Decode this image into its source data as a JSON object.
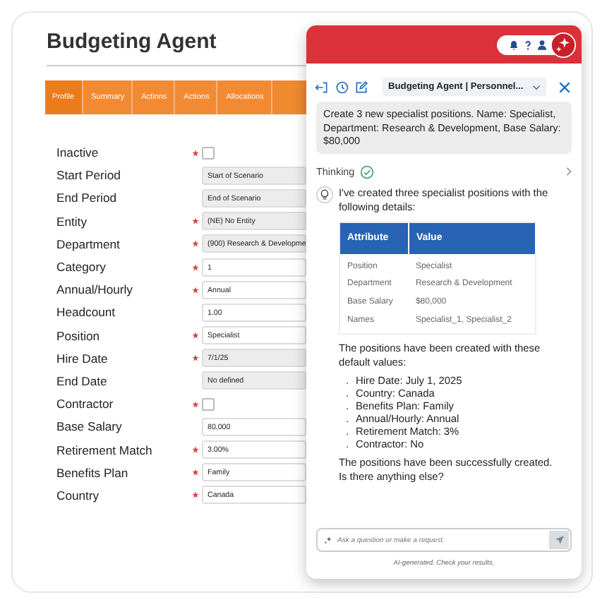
{
  "page": {
    "title": "Budgeting Agent"
  },
  "tabs": [
    {
      "label": "Profile",
      "selected": true
    },
    {
      "label": "Summary",
      "selected": false
    },
    {
      "label": "Actions",
      "selected": false
    },
    {
      "label": "Actions",
      "selected": false
    },
    {
      "label": "Allocations",
      "selected": false
    }
  ],
  "form": [
    {
      "label": "Inactive",
      "kind": "checkbox",
      "required": true,
      "checked": false
    },
    {
      "label": "Start Period",
      "kind": "text",
      "required": false,
      "disabled": true,
      "value": "Start of Scenario"
    },
    {
      "label": "End Period",
      "kind": "text",
      "required": false,
      "disabled": true,
      "value": "End of Scenario"
    },
    {
      "label": "Entity",
      "kind": "text",
      "required": true,
      "disabled": true,
      "value": "(NE) No Entity"
    },
    {
      "label": "Department",
      "kind": "text",
      "required": true,
      "disabled": true,
      "value": "(900) Research & Developme"
    },
    {
      "label": "Category",
      "kind": "text",
      "required": true,
      "disabled": false,
      "value": "1"
    },
    {
      "label": "Annual/Hourly",
      "kind": "text",
      "required": true,
      "disabled": false,
      "value": "Annual"
    },
    {
      "label": "Headcount",
      "kind": "text",
      "required": false,
      "disabled": false,
      "value": "1.00"
    },
    {
      "label": "Position",
      "kind": "text",
      "required": true,
      "disabled": false,
      "value": "Specialist"
    },
    {
      "label": "Hire Date",
      "kind": "text",
      "required": true,
      "disabled": true,
      "value": "7/1/25"
    },
    {
      "label": "End Date",
      "kind": "text",
      "required": false,
      "disabled": true,
      "value": "No defined"
    },
    {
      "label": "Contractor",
      "kind": "checkbox",
      "required": true,
      "checked": false
    },
    {
      "label": "Base Salary",
      "kind": "text",
      "required": false,
      "disabled": false,
      "value": "80,000"
    },
    {
      "label": "Retirement Match",
      "kind": "text",
      "required": true,
      "disabled": false,
      "value": "3.00%"
    },
    {
      "label": "Benefits Plan",
      "kind": "text",
      "required": true,
      "disabled": false,
      "value": "Family"
    },
    {
      "label": "Country",
      "kind": "text",
      "required": true,
      "disabled": false,
      "value": "Canada"
    }
  ],
  "chat": {
    "agent_select": "Budgeting Agent | Personnel...",
    "user_message": "Create 3 new specialist positions. Name: Specialist, Department: Research & Development, Base Salary: $80,000",
    "thinking": {
      "label": "Thinking",
      "done": true
    },
    "reply_intro": "I've created three specialist positions with the following details:",
    "table": {
      "columns": [
        "Attribute",
        "Value"
      ],
      "rows": [
        [
          "Position",
          "Specialist"
        ],
        [
          "Department",
          "Research & Development"
        ],
        [
          "Base Salary",
          "$80,000"
        ],
        [
          "Names",
          "Specialist_1, Specialist_2"
        ]
      ]
    },
    "defaults_intro": "The positions have been created with these default values:",
    "defaults": [
      {
        "marker": ".",
        "text": "Hire Date: July 1, 2025"
      },
      {
        "marker": ".",
        "text": "Country: Canada"
      },
      {
        "marker": ".",
        "text": "Benefits Plan: Family"
      },
      {
        "marker": ".",
        "text": "Annual/Hourly: Annual"
      },
      {
        "marker": ".",
        "text": "Retirement Match: 3%"
      },
      {
        "marker": ".",
        "text": "Contractor: No"
      }
    ],
    "closing": "The positions have been successfully created. Is there anything else?",
    "input": {
      "placeholder": "Ask a question or make a request."
    },
    "footnote": "AI-generated. Check your results."
  }
}
